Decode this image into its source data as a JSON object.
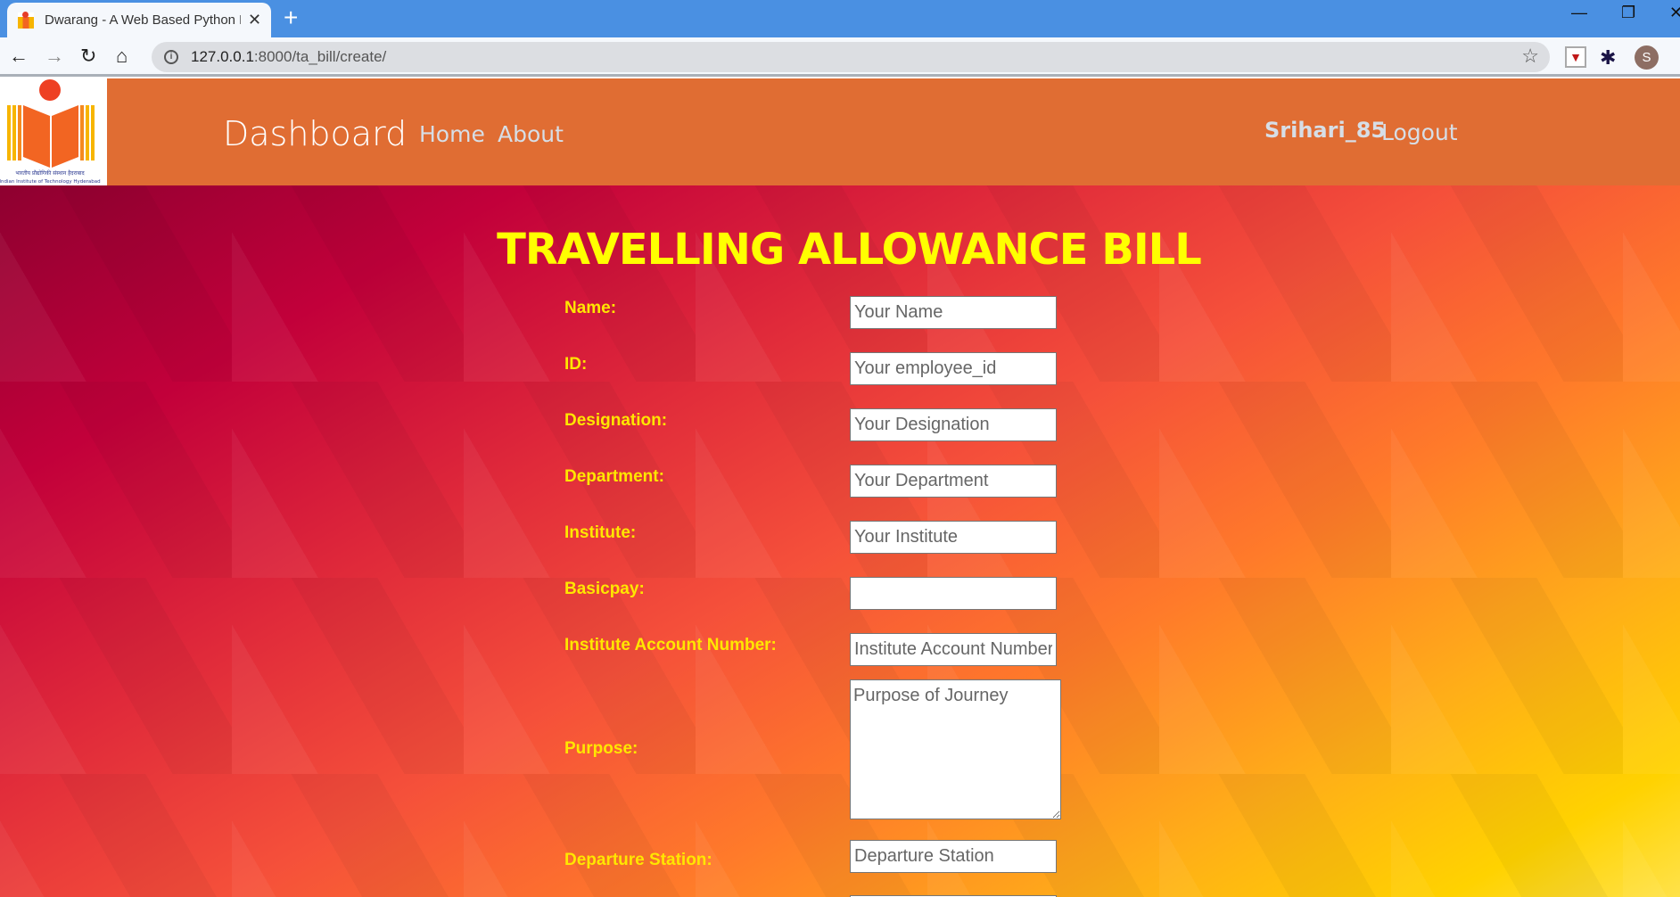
{
  "browser": {
    "tab_title": "Dwarang - A Web Based Python Dashboard",
    "url_host": "127.0.0.1",
    "url_rest": ":8000/ta_bill/create/",
    "profile_initial": "S"
  },
  "navbar": {
    "brand": "Dashboard",
    "links": [
      "Home",
      "About"
    ],
    "username": "Srihari_85",
    "logout": "Logout",
    "logo_text": [
      "भारतीय प्रौद्योगिकी संस्थान हैदराबाद",
      "Indian Institute of Technology Hyderabad"
    ]
  },
  "form": {
    "title": "TRAVELLING ALLOWANCE BILL",
    "fields": [
      {
        "label": "Name:",
        "placeholder": "Your Name"
      },
      {
        "label": "ID:",
        "placeholder": "Your employee_id"
      },
      {
        "label": "Designation:",
        "placeholder": "Your Designation"
      },
      {
        "label": "Department:",
        "placeholder": "Your Department"
      },
      {
        "label": "Institute:",
        "placeholder": "Your Institute"
      },
      {
        "label": "Basicpay:",
        "placeholder": ""
      },
      {
        "label": "Institute Account Number:",
        "placeholder": "Institute Account Number"
      },
      {
        "label": "Purpose:",
        "placeholder": "Purpose of Journey"
      },
      {
        "label": "Departure Station:",
        "placeholder": "Departure Station"
      }
    ]
  },
  "colors": {
    "navbar": "#e06d33",
    "heading": "#ffff00",
    "label": "#ffe600",
    "tabbar": "#4a90e2"
  }
}
